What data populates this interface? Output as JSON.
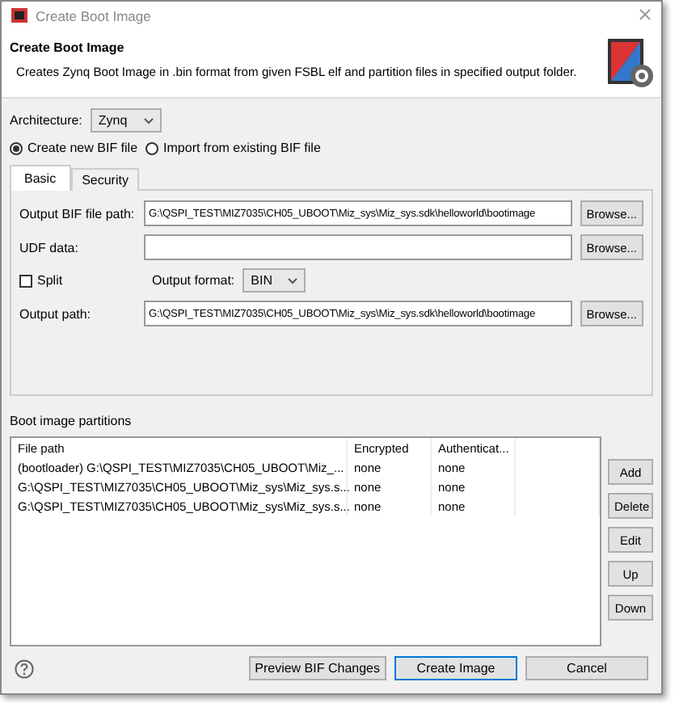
{
  "window": {
    "title": "Create Boot Image"
  },
  "header": {
    "title": "Create Boot Image",
    "description": "Creates Zynq Boot Image in .bin format from given FSBL elf and partition files in specified output folder."
  },
  "architecture": {
    "label": "Architecture:",
    "value": "Zynq"
  },
  "modes": [
    {
      "label": "Create new BIF file",
      "selected": true
    },
    {
      "label": "Import from existing BIF file",
      "selected": false
    }
  ],
  "tabs": [
    {
      "label": "Basic",
      "selected": true
    },
    {
      "label": "Security",
      "selected": false
    }
  ],
  "fields": [
    {
      "label": "Output BIF file path:",
      "value": "G:\\QSPI_TEST\\MIZ7035\\CH05_UBOOT\\Miz_sys\\Miz_sys.sdk\\helloworld\\bootimage",
      "button": "Browse..."
    },
    {
      "label": "UDF data:",
      "button": "Browse..."
    }
  ],
  "split": {
    "label": "Split",
    "checked": false
  },
  "output_format": {
    "label": "Output format:",
    "value": "BIN"
  },
  "output_path": {
    "label": "Output path:",
    "value": "G:\\QSPI_TEST\\MIZ7035\\CH05_UBOOT\\Miz_sys\\Miz_sys.sdk\\helloworld\\bootimage",
    "button": "Browse..."
  },
  "partitions": {
    "title": "Boot image partitions",
    "columns": [
      "File path",
      "Encrypted",
      "Authenticat..."
    ],
    "rows": [
      [
        "(bootloader) G:\\QSPI_TEST\\MIZ7035\\CH05_UBOOT\\Miz_...",
        "none",
        "none"
      ],
      [
        "G:\\QSPI_TEST\\MIZ7035\\CH05_UBOOT\\Miz_sys\\Miz_sys.s...",
        "none",
        "none"
      ],
      [
        "G:\\QSPI_TEST\\MIZ7035\\CH05_UBOOT\\Miz_sys\\Miz_sys.s...",
        "none",
        "none"
      ]
    ],
    "buttons": [
      "Add",
      "Delete",
      "Edit",
      "Up",
      "Down"
    ]
  },
  "footer": {
    "buttons": [
      {
        "label": "Preview BIF Changes",
        "default": false
      },
      {
        "label": "Create Image",
        "default": true
      },
      {
        "label": "Cancel",
        "default": false
      }
    ]
  }
}
